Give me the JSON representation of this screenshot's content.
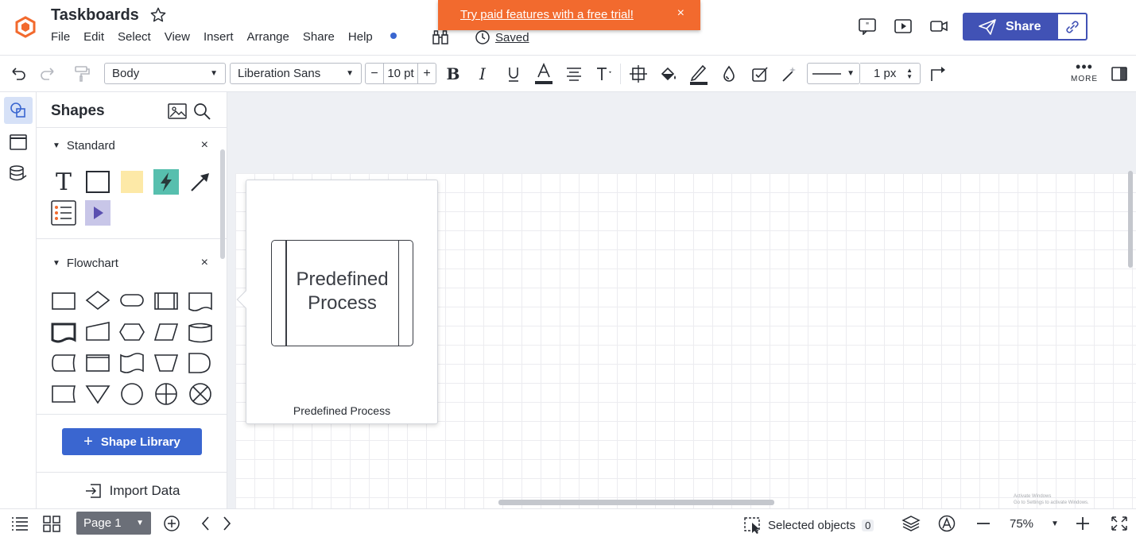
{
  "header": {
    "title": "Taskboards",
    "menu": [
      "File",
      "Edit",
      "Select",
      "View",
      "Insert",
      "Arrange",
      "Share",
      "Help"
    ],
    "saved_label": "Saved",
    "banner_text": "Try paid features with a free trial!",
    "banner_close": "×",
    "share_label": "Share",
    "brand_color": "#f26a2e",
    "share_color": "#4152b5"
  },
  "toolbar": {
    "style_select": "Body",
    "font_select": "Liberation Sans",
    "font_size": "10 pt",
    "minus": "−",
    "plus": "+",
    "line_width": "1 px",
    "more_label": "MORE"
  },
  "panel": {
    "title": "Shapes",
    "sections": [
      {
        "name": "Standard",
        "close": "×"
      },
      {
        "name": "Flowchart",
        "close": "×"
      }
    ],
    "library_button": "Shape Library",
    "import_label": "Import Data"
  },
  "preview": {
    "shape_text_line1": "Predefined",
    "shape_text_line2": "Process",
    "caption": "Predefined Process"
  },
  "watermark": {
    "line1": "Activate Windows",
    "line2": "Go to Settings to activate Windows."
  },
  "bottombar": {
    "page_tab": "Page 1",
    "selected_label": "Selected objects",
    "selected_count": "0",
    "zoom": "75%"
  }
}
